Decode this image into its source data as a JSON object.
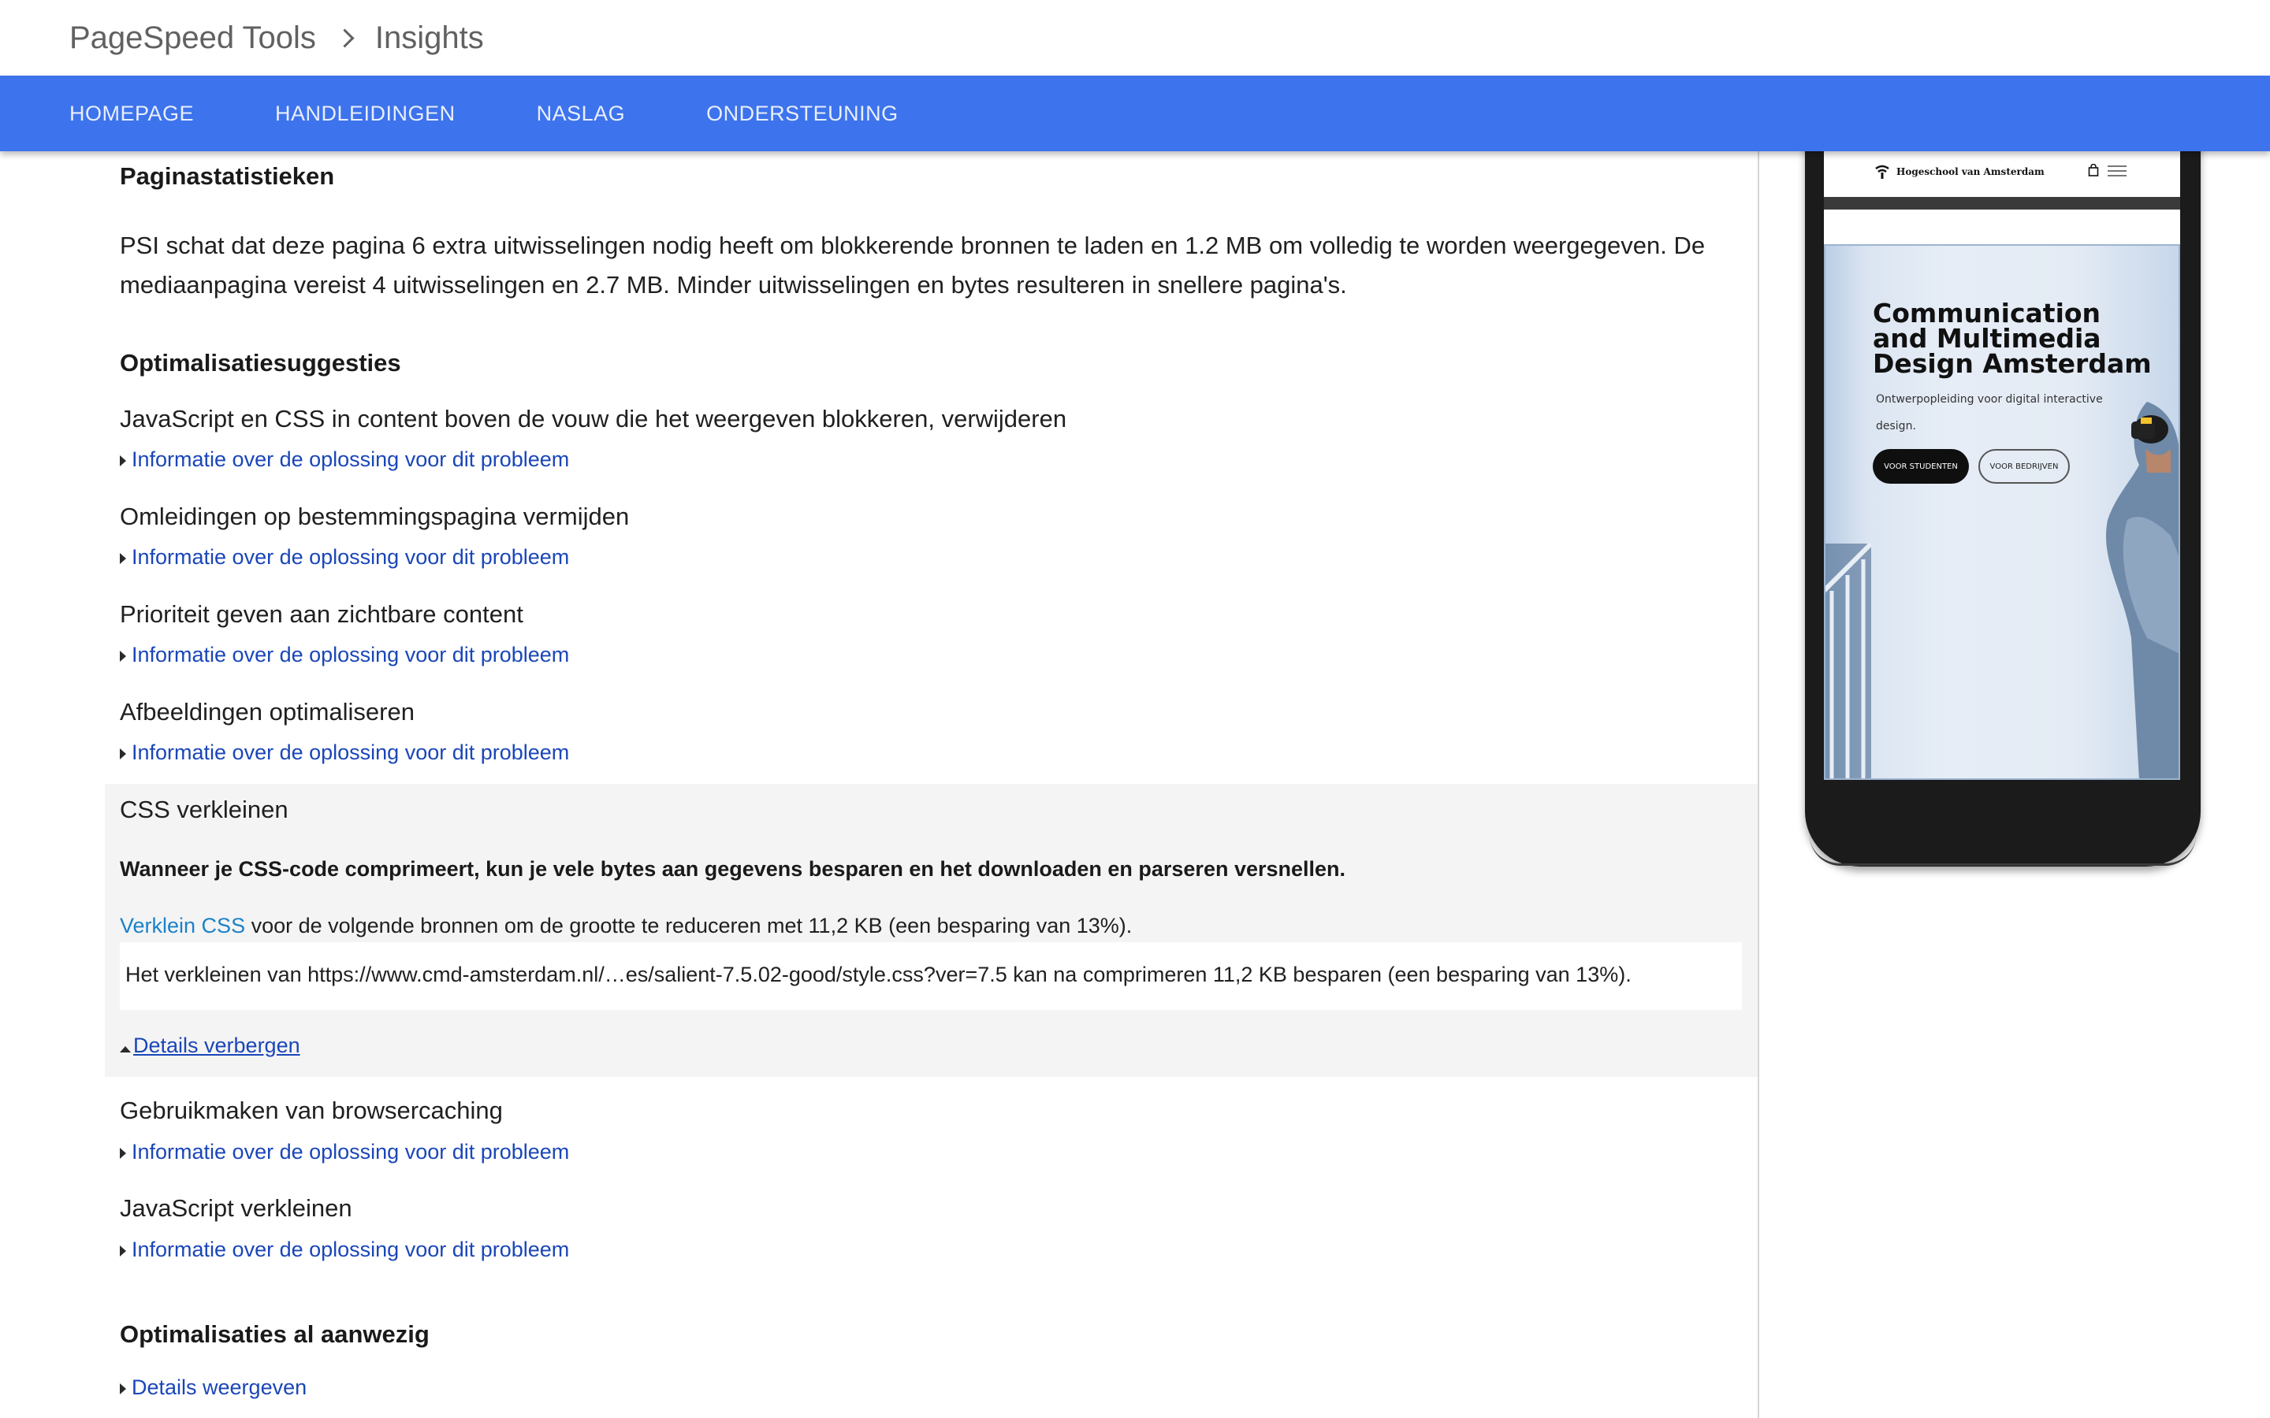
{
  "breadcrumb": {
    "root": "PageSpeed Tools",
    "current": "Insights"
  },
  "nav": {
    "items": [
      {
        "label": "HOMEPAGE"
      },
      {
        "label": "HANDLEIDINGEN"
      },
      {
        "label": "NASLAG"
      },
      {
        "label": "ONDERSTEUNING"
      }
    ]
  },
  "stats": {
    "title": "Paginastatistieken",
    "text": "PSI schat dat deze pagina 6 extra uitwisselingen nodig heeft om blokkerende bronnen te laden en 1.2 MB om volledig te worden weergegeven. De mediaanpagina vereist 4 uitwisselingen en 2.7 MB. Minder uitwisselingen en bytes resulteren in snellere pagina's."
  },
  "suggestions": {
    "title": "Optimalisatiesuggesties",
    "link_label": "Informatie over de oplossing voor dit probleem",
    "rules": [
      {
        "title": "JavaScript en CSS in content boven de vouw die het weergeven blokkeren, verwijderen"
      },
      {
        "title": "Omleidingen op bestemmingspagina vermijden"
      },
      {
        "title": "Prioriteit geven aan zichtbare content"
      },
      {
        "title": "Afbeeldingen optimaliseren"
      }
    ],
    "expanded": {
      "title": "CSS verkleinen",
      "summary": "Wanneer je CSS-code comprimeert, kun je vele bytes aan gegevens besparen en het downloaden en parseren versnellen.",
      "link_text": "Verklein CSS",
      "detail_text": " voor de volgende bronnen om de grootte te reduceren met 11,2 KB (een besparing van 13%).",
      "resource": "Het verkleinen van https://www.cmd-amsterdam.nl/…es/salient-7.5.02-good/style.css?ver=7.5 kan na comprimeren 11,2 KB besparen (een besparing van 13%).",
      "hide_label": "Details verbergen"
    },
    "rules_after": [
      {
        "title": "Gebruikmaken van browsercaching"
      },
      {
        "title": "JavaScript verkleinen"
      }
    ]
  },
  "present": {
    "title": "Optimalisaties al aanwezig",
    "show_label": "Details weergeven"
  },
  "preview": {
    "site_name": "Hogeschool van Amsterdam",
    "hero_title": "Communication and Multimedia Design Amsterdam",
    "hero_sub": "Ontwerpopleiding voor digital interactive design.",
    "btn_students": "VOOR STUDENTEN",
    "btn_companies": "VOOR BEDRIJVEN"
  },
  "colors": {
    "nav_bg": "#3d73ec",
    "link": "#1a46b8",
    "expanded_bg": "#f4f4f4"
  }
}
